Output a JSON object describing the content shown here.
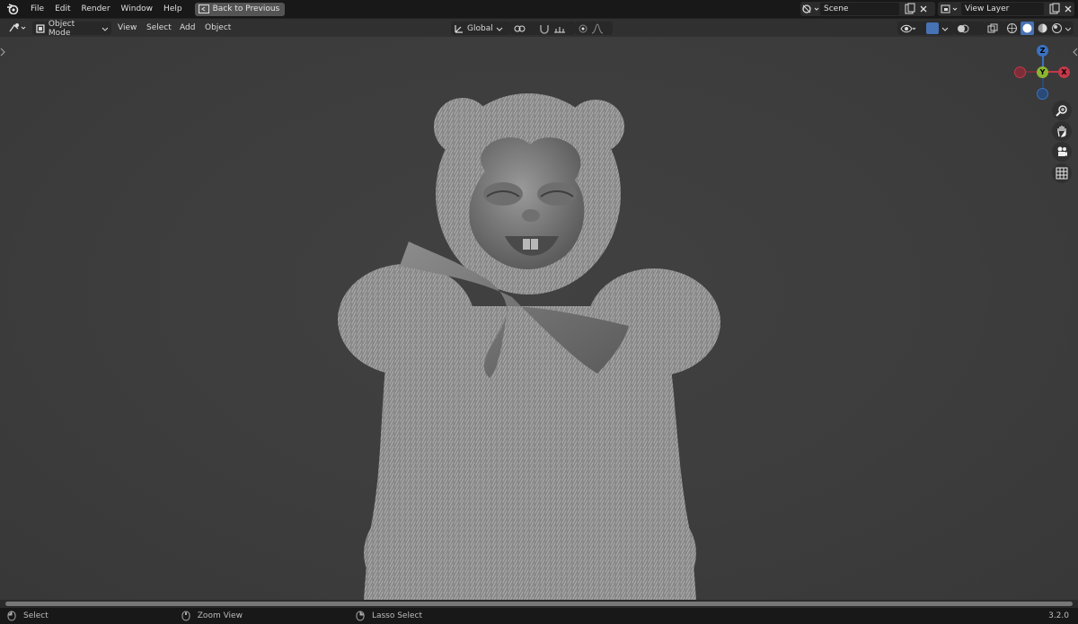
{
  "topbar": {
    "menus": [
      "File",
      "Edit",
      "Render",
      "Window",
      "Help"
    ],
    "back_button": "Back to Previous",
    "scene_name": "Scene",
    "view_layer_name": "View Layer"
  },
  "viewport_header": {
    "mode": "Object Mode",
    "menus": [
      "View",
      "Select",
      "Add",
      "Object"
    ],
    "transform_orientation": "Global"
  },
  "gizmo": {
    "z": "Z",
    "y": "Y",
    "x": "X"
  },
  "statusbar": {
    "select": "Select",
    "zoom_view": "Zoom View",
    "lasso_select": "Lasso Select",
    "version": "3.2.0"
  },
  "colors": {
    "accent": "#4772b3",
    "x_axis": "#c4384a",
    "y_axis": "#8bb531",
    "z_axis": "#3a72c2"
  }
}
